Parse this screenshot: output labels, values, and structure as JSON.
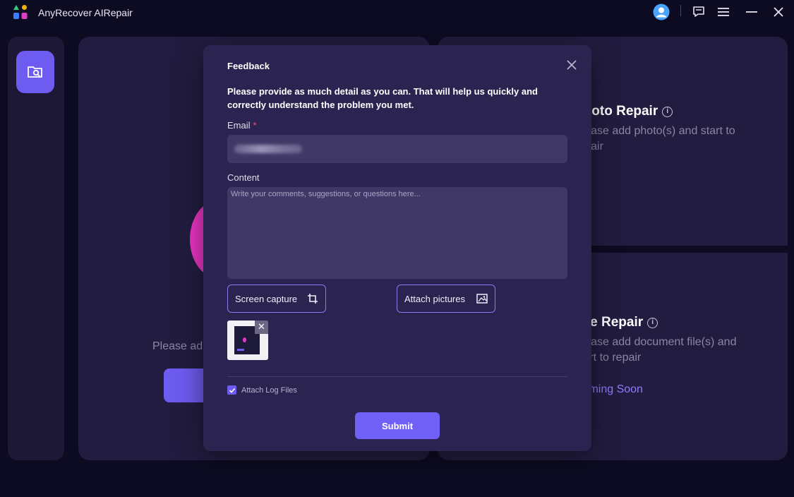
{
  "app": {
    "title": "AnyRecover AIRepair"
  },
  "titlebar": {
    "icons": [
      "avatar-icon",
      "feedback-icon",
      "menu-icon",
      "minimize-icon",
      "close-icon"
    ]
  },
  "background": {
    "main_panel": {
      "text": "Please ad"
    },
    "photo_panel": {
      "title": "Photo Repair",
      "subtitle": "Please add photo(s) and start to repair"
    },
    "file_panel": {
      "title": "File Repair",
      "subtitle": "Please add document file(s) and start to repair",
      "status": "Coming Soon"
    }
  },
  "feedback": {
    "title": "Feedback",
    "description": "Please provide as much detail as you can. That will help us quickly and correctly understand the problem you met.",
    "email_label": "Email",
    "email_required_mark": "*",
    "content_label": "Content",
    "content_placeholder": "Write your comments, suggestions, or questions here...",
    "screen_capture_label": "Screen capture",
    "attach_pictures_label": "Attach pictures",
    "attachment_remove": "✕",
    "attach_log_label": "Attach Log Files",
    "attach_log_checked": true,
    "submit_label": "Submit"
  },
  "colors": {
    "accent": "#6e5cf0",
    "background": "#0d0b22",
    "panel": "#221d40",
    "modal": "#2b2350",
    "required": "#ff4f6e",
    "coming_soon": "#8f7bff"
  }
}
